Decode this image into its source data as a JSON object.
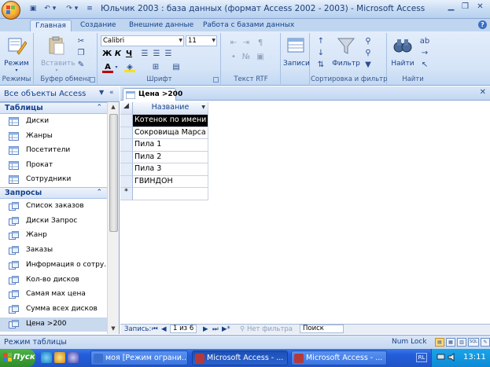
{
  "window": {
    "title": "Юльчик 2003 : база данных (формат Access 2002 - 2003)  -  Microsoft Access",
    "controls": [
      "minimize",
      "restore",
      "close"
    ]
  },
  "quick_access": [
    "save-icon",
    "undo-icon",
    "redo-icon",
    "customize-icon"
  ],
  "ribbon": {
    "tabs": [
      "Главная",
      "Создание",
      "Внешние данные",
      "Работа с базами данных"
    ],
    "active_tab": "Главная",
    "groups": {
      "views": {
        "label": "Режимы",
        "button": "Режим"
      },
      "clipboard": {
        "label": "Буфер обмена",
        "paste": "Вставить"
      },
      "font": {
        "label": "Шрифт",
        "font_name": "Calibri",
        "font_size": "11",
        "bold": "Ж",
        "italic": "К",
        "underline": "Ч",
        "font_color_letter": "A"
      },
      "rich_text": {
        "label": "Текст RTF"
      },
      "records": {
        "button": "Записи"
      },
      "sort_filter": {
        "label": "Сортировка и фильтр",
        "filter": "Фильтр"
      },
      "find": {
        "label": "Найти",
        "button": "Найти"
      }
    }
  },
  "navigation": {
    "header": "Все объекты Access",
    "groups": [
      {
        "label": "Таблицы",
        "items": [
          "Диски",
          "Жанры",
          "Посетители",
          "Прокат",
          "Сотрудники"
        ]
      },
      {
        "label": "Запросы",
        "items": [
          "Список заказов",
          "Диски Запрос",
          "Жанр",
          "Заказы",
          "Информация о сотру...",
          "Кол-во дисков",
          "Самая мах цена",
          "Сумма всех дисков",
          "Цена >200"
        ]
      }
    ],
    "selected_item": "Цена >200"
  },
  "document": {
    "tab_title": "Цена >200",
    "column_header": "Название",
    "rows": [
      "Котенок по имени",
      "Сокровища Марса",
      "Пила 1",
      "Пила 2",
      "Пила 3",
      "ГВИНДОН"
    ],
    "new_row_marker": "*"
  },
  "record_nav": {
    "label": "Запись:",
    "position": "1 из 6",
    "filter_label": "Нет фильтра",
    "search_placeholder": "Поиск"
  },
  "status": {
    "mode": "Режим таблицы",
    "numlock": "Num Lock",
    "view_buttons": [
      "datasheet",
      "pivot-table",
      "pivot-chart",
      "SQL",
      "design"
    ],
    "sql_label": "SQL"
  },
  "taskbar": {
    "start": "Пуск",
    "buttons": [
      {
        "label": "моя [Режим ограни...",
        "active": false
      },
      {
        "label": "Microsoft Access - ...",
        "active": true
      },
      {
        "label": "Microsoft Access - ...",
        "active": false
      }
    ],
    "language": "RL",
    "clock": "13:11"
  }
}
